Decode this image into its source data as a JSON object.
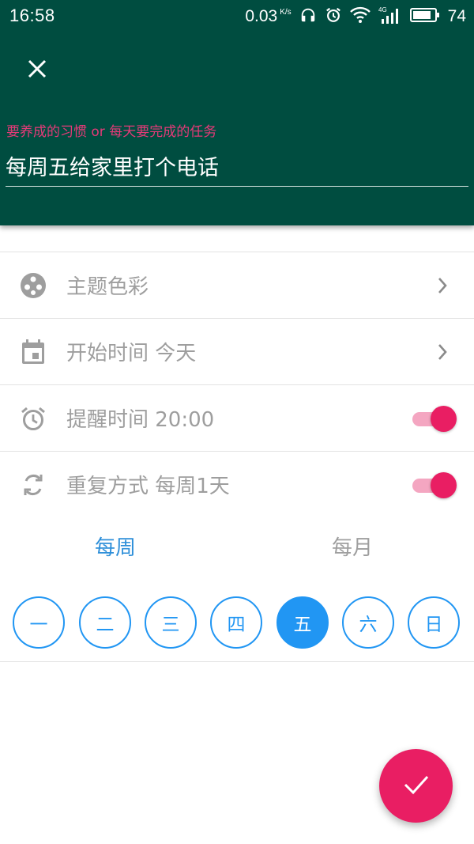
{
  "status_bar": {
    "time": "16:58",
    "net_speed": "0.03",
    "net_unit": "K/s",
    "network_type": "4G",
    "battery_level": "74",
    "icons": [
      "headphones-icon",
      "alarm-icon",
      "wifi-icon",
      "signal-icon",
      "battery-icon"
    ]
  },
  "header": {
    "background_color": "#004d40",
    "close_icon": "close-icon",
    "task_label": "要养成的习惯 or 每天要完成的任务",
    "task_label_color": "#e53a78",
    "task_value": "每周五给家里打个电话"
  },
  "settings": {
    "rows": [
      {
        "icon": "palette-icon",
        "label": "主题色彩",
        "control": "chevron-right-icon"
      },
      {
        "icon": "calendar-icon",
        "label": "开始时间 今天",
        "control": "chevron-right-icon"
      },
      {
        "icon": "alarm-icon",
        "label": "提醒时间 20:00",
        "control": "toggle",
        "enabled": true
      },
      {
        "icon": "repeat-icon",
        "label": "重复方式 每周1天",
        "control": "toggle",
        "enabled": true
      }
    ]
  },
  "repeat_tabs": {
    "weekly": "每周",
    "monthly": "每月",
    "selected": "weekly",
    "active_color": "#2e8fd9"
  },
  "weekdays": {
    "days": [
      "一",
      "二",
      "三",
      "四",
      "五",
      "六",
      "日"
    ],
    "selected_index": 4,
    "color": "#2196f3"
  },
  "fab": {
    "icon": "check-icon",
    "color": "#e91e63"
  }
}
